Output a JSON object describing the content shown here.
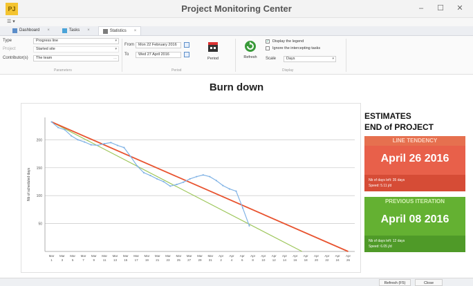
{
  "window": {
    "title": "Project Monitoring Center",
    "app_icon_text": "PJ",
    "minimize": "–",
    "maximize": "☐",
    "close": "✕"
  },
  "qat_label": "☰ ▾",
  "tabs": [
    {
      "label": "Dashboard",
      "icon": "dashboard-icon"
    },
    {
      "label": "Tasks",
      "icon": "tasks-icon"
    },
    {
      "label": "Statistics",
      "icon": "statistics-icon",
      "active": true
    }
  ],
  "ribbon": {
    "type_label": "Type",
    "type_value": "Progress line",
    "project_label": "Project",
    "project_value": "Started site",
    "contributors_label": "Contributor(s)",
    "contributors_value": "The team",
    "parameters_group": "Parameters",
    "from_label": "From",
    "from_value": "Mon 22 February 2016",
    "to_label": "To",
    "to_value": "Wed 27 April 2016",
    "period_group": "Period",
    "period_button": "Period",
    "refresh_button": "Refresh",
    "display_legend": "Display the legend",
    "ignore_label": "Ignore the intercepting tasks",
    "scale_label": "Scale",
    "scale_value": "Days",
    "display_group": "Display"
  },
  "chart_title": "Burn down",
  "estimates": {
    "heading_line1": "ESTIMATES",
    "heading_line2": "END of PROJECT",
    "line_tendency": {
      "header": "LINE TENDENCY",
      "date": "April 26 2016",
      "meta1": "Nb of days left: 35 days",
      "meta2": "Speed: 5.11 j/d"
    },
    "previous_iteration": {
      "header": "PREVIOUS ITERATION",
      "date": "April 08 2016",
      "meta1": "Nb of days left: 12 days",
      "meta2": "Speed: 6.05 j/d"
    }
  },
  "status": {
    "refresh": "Refresh (F5)",
    "close": "Close"
  },
  "colors": {
    "tendency": "#e8532f",
    "previous": "#9dc65a",
    "actual": "#7fb2e5",
    "card_red": "#e8604a",
    "card_green": "#64b132"
  },
  "chart_data": {
    "type": "line",
    "title": "Burn down",
    "ylabel": "Nb of scheduled days",
    "xlabel": "",
    "ylim": [
      0,
      240
    ],
    "yticks": [
      50,
      100,
      150,
      200
    ],
    "categories": [
      "Mar 1",
      "Mar 3",
      "Mar 5",
      "Mar 7",
      "Mar 9",
      "Mar 11",
      "Mar 13",
      "Mar 15",
      "Mar 17",
      "Mar 19",
      "Mar 21",
      "Mar 23",
      "Mar 25",
      "Mar 27",
      "Mar 29",
      "Mar 31",
      "Apr 2",
      "Apr 4",
      "Apr 6",
      "Apr 8",
      "Apr 10",
      "Apr 12",
      "Apr 14",
      "Apr 16",
      "Apr 18",
      "Apr 20",
      "Apr 22",
      "Apr 24",
      "Apr 26"
    ],
    "x_tick_labels": [
      "Mar\n1",
      "Mar\n3",
      "Mar\n5",
      "Mar\n7",
      "Mar\n9",
      "Mar\n11",
      "Mar\n13",
      "Mar\n15",
      "Mar\n17",
      "Mar\n19",
      "Mar\n21",
      "Mar\n23",
      "Mar\n25",
      "Mar\n27",
      "Mar\n29",
      "Mar\n31",
      "Apr\n2",
      "Apr\n4",
      "Apr\n6",
      "Apr\n8",
      "Apr\n10",
      "Apr\n12",
      "Apr\n14",
      "Apr\n16",
      "Apr\n18",
      "Apr\n20",
      "Apr\n22",
      "Apr\n24",
      "Apr\n26"
    ],
    "series": [
      {
        "name": "Actual",
        "color": "#7fb2e5",
        "points": [
          [
            0,
            232
          ],
          [
            1,
            222
          ],
          [
            2,
            218
          ],
          [
            3,
            207
          ],
          [
            4,
            200
          ],
          [
            5,
            196
          ],
          [
            6,
            191
          ],
          [
            7,
            190
          ],
          [
            8,
            193
          ],
          [
            9,
            195
          ],
          [
            10,
            190
          ],
          [
            11,
            186
          ],
          [
            12,
            170
          ],
          [
            13,
            153
          ],
          [
            14,
            141
          ],
          [
            15,
            136
          ],
          [
            16,
            130
          ],
          [
            17,
            125
          ],
          [
            18,
            117
          ],
          [
            19,
            120
          ],
          [
            20,
            124
          ],
          [
            21,
            130
          ],
          [
            22,
            134
          ],
          [
            23,
            137
          ],
          [
            24,
            134
          ],
          [
            25,
            127
          ],
          [
            26,
            118
          ],
          [
            27,
            112
          ],
          [
            28,
            108
          ],
          [
            29,
            78
          ],
          [
            30,
            46
          ]
        ]
      },
      {
        "name": "Line tendency",
        "color": "#e8532f",
        "points": [
          [
            0,
            232
          ],
          [
            45,
            0
          ]
        ]
      },
      {
        "name": "Previous iteration",
        "color": "#9dc65a",
        "points": [
          [
            0,
            232
          ],
          [
            38,
            0
          ]
        ]
      }
    ],
    "xlim": [
      -1,
      46
    ],
    "grid": true,
    "legend": "none"
  }
}
